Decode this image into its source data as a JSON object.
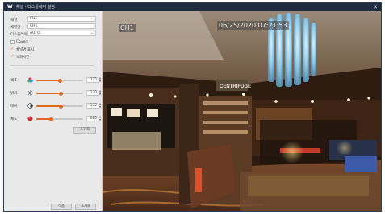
{
  "window": {
    "title": "채널 - 디스플레이 설정",
    "close_symbol": "✕"
  },
  "panel": {
    "channel_label": "채널",
    "channel_value": "CH1",
    "channel_name_label": "채널명",
    "channel_name_value": "CH1",
    "mode_label": "디스플레이",
    "mode_value": "AUTO",
    "covert_label": "Covert",
    "covert_checked": false,
    "hide_channel_label": "채널명 표시",
    "hide_channel_checked": true,
    "show_time_label": "녹화시간",
    "show_time_checked": true,
    "sliders": [
      {
        "label": "색조",
        "icon": "hue-icon",
        "value": "125",
        "fraction": 0.5
      },
      {
        "label": "밝기",
        "icon": "brightness-icon",
        "value": "130",
        "fraction": 0.52
      },
      {
        "label": "대비",
        "icon": "contrast-icon",
        "value": "132",
        "fraction": 0.53
      },
      {
        "label": "채도",
        "icon": "saturation-icon",
        "value": "080",
        "fraction": 0.32
      }
    ],
    "reset_button": "초기화",
    "apply_button": "적용",
    "cancel_button": "초기화"
  },
  "video": {
    "channel_overlay": "CH1",
    "timestamp": "06/25/2020 07:21:53",
    "sign_text": "CENTRIFUGE"
  },
  "colors": {
    "accent": "#e06a1b",
    "titlebar": "#1f2b3e"
  }
}
